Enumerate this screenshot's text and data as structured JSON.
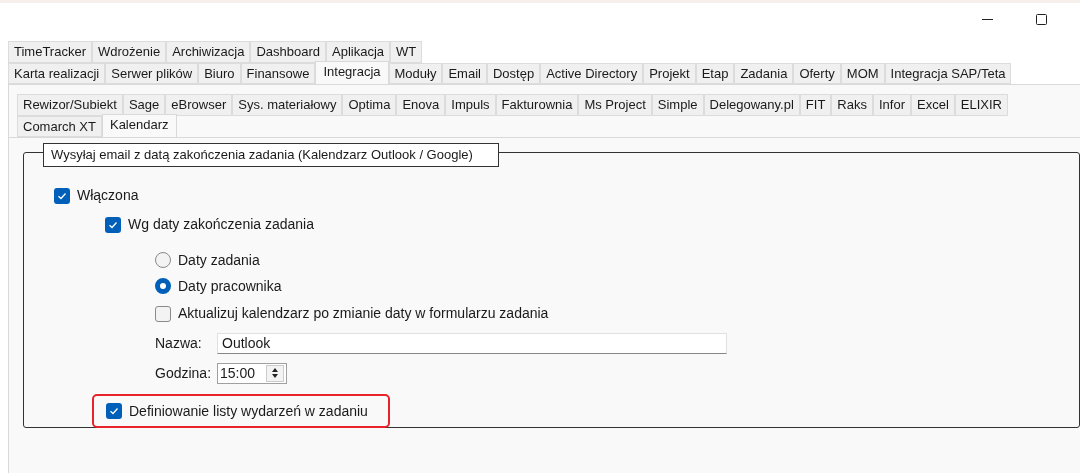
{
  "tab_rows": [
    [
      {
        "label": "TimeTracker",
        "selected": false
      },
      {
        "label": "Wdrożenie",
        "selected": false
      },
      {
        "label": "Archiwizacja",
        "selected": false
      },
      {
        "label": "Dashboard",
        "selected": false
      },
      {
        "label": "Aplikacja",
        "selected": false
      },
      {
        "label": "WT",
        "selected": false
      }
    ],
    [
      {
        "label": "Karta realizacji",
        "selected": false
      },
      {
        "label": "Serwer plików",
        "selected": false
      },
      {
        "label": "Biuro",
        "selected": false
      },
      {
        "label": "Finansowe",
        "selected": false
      },
      {
        "label": "Integracja",
        "selected": true
      },
      {
        "label": "Moduły",
        "selected": false
      },
      {
        "label": "Email",
        "selected": false
      },
      {
        "label": "Dostęp",
        "selected": false
      },
      {
        "label": "Active Directory",
        "selected": false
      },
      {
        "label": "Projekt",
        "selected": false
      },
      {
        "label": "Etap",
        "selected": false
      },
      {
        "label": "Zadania",
        "selected": false
      },
      {
        "label": "Oferty",
        "selected": false
      },
      {
        "label": "MOM",
        "selected": false
      },
      {
        "label": "Integracja SAP/Teta",
        "selected": false
      }
    ]
  ],
  "subtab_rows": [
    [
      {
        "label": "Rewizor/Subiekt",
        "selected": false
      },
      {
        "label": "Sage",
        "selected": false
      },
      {
        "label": "eBrowser",
        "selected": false
      },
      {
        "label": "Sys. materiałowy",
        "selected": false
      },
      {
        "label": "Optima",
        "selected": false
      },
      {
        "label": "Enova",
        "selected": false
      },
      {
        "label": "Impuls",
        "selected": false
      },
      {
        "label": "Fakturownia",
        "selected": false
      },
      {
        "label": "Ms Project",
        "selected": false
      },
      {
        "label": "Simple",
        "selected": false
      },
      {
        "label": "Delegowany.pl",
        "selected": false
      },
      {
        "label": "FIT",
        "selected": false
      },
      {
        "label": "Raks",
        "selected": false
      },
      {
        "label": "Infor",
        "selected": false
      },
      {
        "label": "Excel",
        "selected": false
      },
      {
        "label": "ELIXIR",
        "selected": false
      }
    ],
    [
      {
        "label": "Comarch XT",
        "selected": false
      },
      {
        "label": "Kalendarz",
        "selected": true
      }
    ]
  ],
  "group": {
    "title": "Wysyłaj email z datą zakończenia zadania (Kalendzarz Outlook / Google)",
    "items": [
      {
        "kind": "checkbox",
        "label": "Włączona",
        "checked": true,
        "children": [
          {
            "kind": "checkbox",
            "label": "Wg daty zakończenia zadania",
            "checked": true,
            "children": [
              {
                "kind": "radio",
                "label": "Daty zadania",
                "selected": false
              },
              {
                "kind": "radio",
                "label": "Daty pracownika",
                "selected": true
              },
              {
                "kind": "checkbox",
                "label": "Aktualizuj kalendzarz po zmianie daty w formularzu zadania",
                "checked": false,
                "highlighted": false
              },
              {
                "kind": "field",
                "label": "Nazwa:",
                "value": "Outlook"
              },
              {
                "kind": "spinner",
                "label": "Godzina:",
                "value": "15:00"
              }
            ]
          },
          {
            "kind": "checkbox",
            "label": "Definiowanie listy wydarzeń w zadaniu",
            "checked": true,
            "highlighted": true
          }
        ]
      }
    ]
  }
}
